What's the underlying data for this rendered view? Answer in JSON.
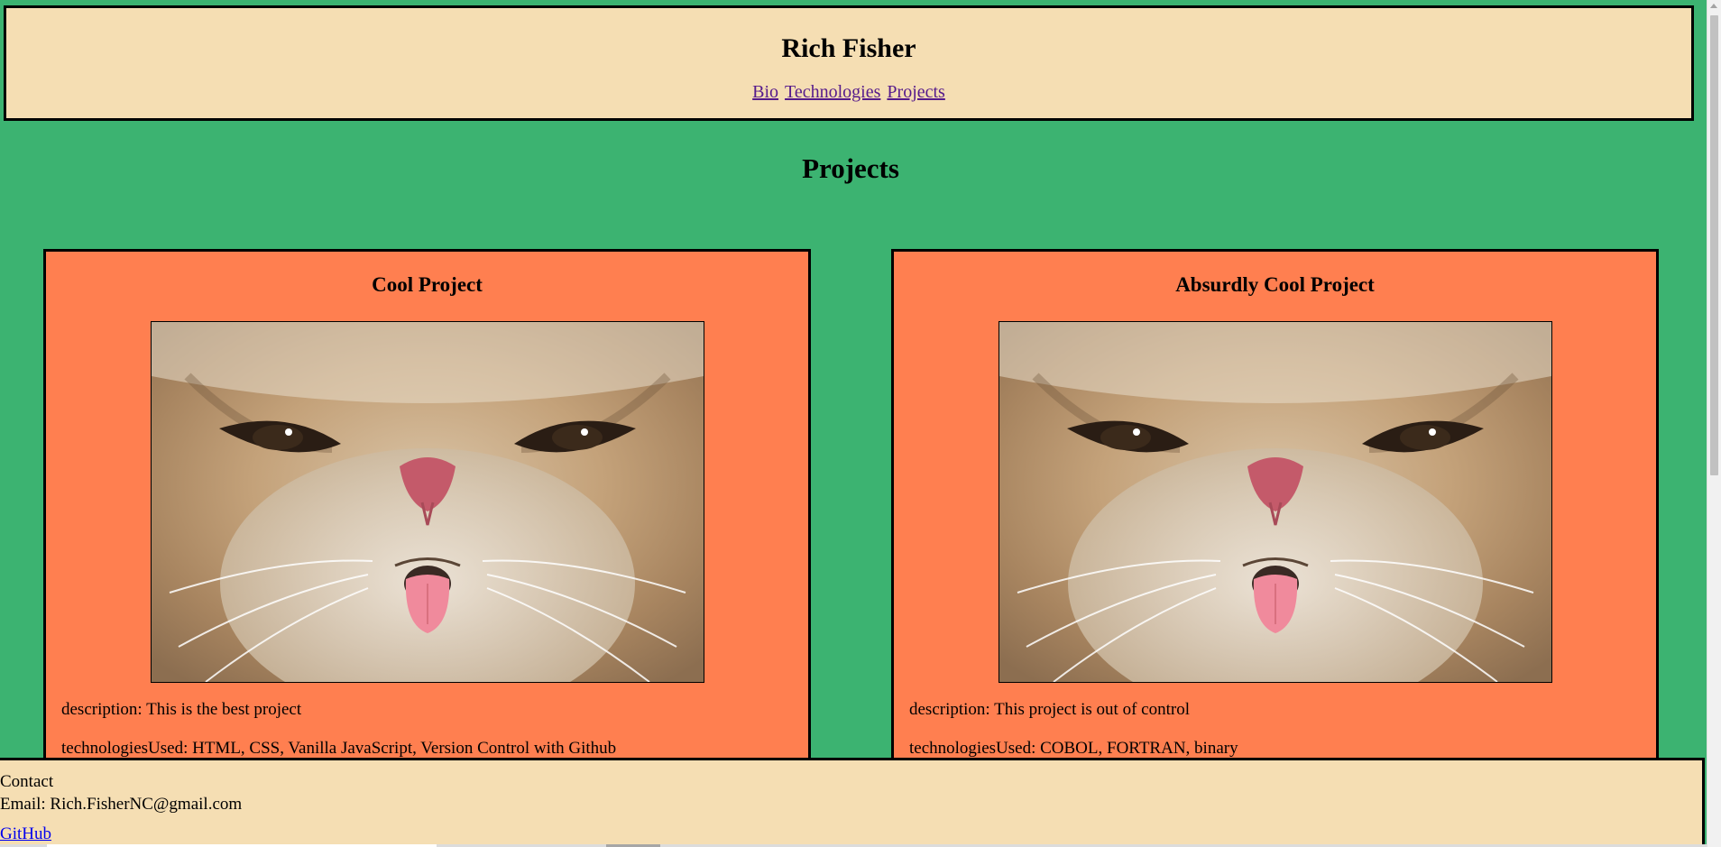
{
  "header": {
    "title": "Rich Fisher",
    "nav": [
      {
        "label": "Bio"
      },
      {
        "label": "Technologies"
      },
      {
        "label": "Projects"
      }
    ]
  },
  "page": {
    "title": "Projects"
  },
  "projects": [
    {
      "title": "Cool Project",
      "image": "grumpy-cat-face-photo",
      "description": "description: This is the best project",
      "technologies": "technologiesUsed: HTML, CSS, Vanilla JavaScript, Version Control with Github"
    },
    {
      "title": "Absurdly Cool Project",
      "image": "grumpy-cat-face-photo",
      "description": "description: This project is out of control",
      "technologies": "technologiesUsed: COBOL, FORTRAN, binary"
    }
  ],
  "footer": {
    "heading": "Contact",
    "email": "Email: Rich.FisherNC@gmail.com",
    "github_label": "GitHub"
  },
  "colors": {
    "page_bg": "#3cb371",
    "header_bg": "#f5deb3",
    "card_bg": "#ff7f50",
    "link_visited": "#551a8b",
    "link": "#0000ee"
  }
}
